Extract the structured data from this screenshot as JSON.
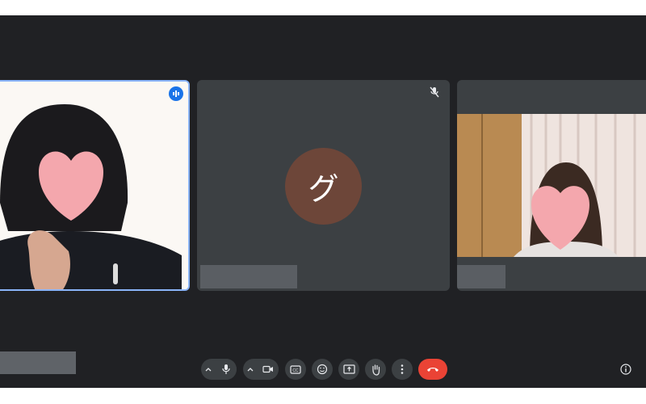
{
  "participants": [
    {
      "id": "p1",
      "speaking": true,
      "video_on": true,
      "name": ""
    },
    {
      "id": "p2",
      "video_on": false,
      "muted": true,
      "avatar_letter": "グ",
      "avatar_color": "#6d4639",
      "name": ""
    },
    {
      "id": "p3",
      "video_on": true,
      "name": ""
    }
  ],
  "toolbar": {
    "buttons": [
      "mic",
      "camera",
      "captions",
      "reactions",
      "present",
      "raise-hand",
      "more-options",
      "end-call",
      "meeting-info"
    ]
  },
  "colors": {
    "background": "#202124",
    "tile": "#3c4043",
    "active_border": "#8ab4f8",
    "end_call": "#ea4335",
    "avatar": "#6d4639"
  }
}
